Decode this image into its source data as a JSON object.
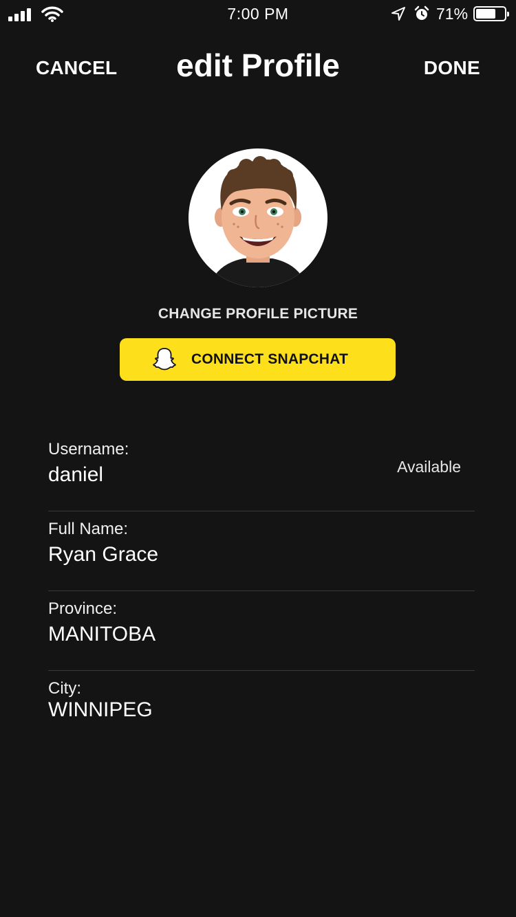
{
  "status_bar": {
    "time": "7:00 PM",
    "battery_percent": "71%",
    "battery_level": 0.71,
    "icons": [
      "signal-icon",
      "wifi-icon",
      "location-icon",
      "alarm-icon",
      "battery-icon"
    ]
  },
  "nav": {
    "cancel_label": "CANCEL",
    "title": "edit Profile",
    "done_label": "DONE"
  },
  "profile": {
    "avatar_icon": "bitmoji-avatar",
    "change_picture_label": "CHANGE PROFILE PICTURE",
    "snapchat_button_label": "CONNECT SNAPCHAT",
    "snapchat_icon": "snapchat-ghost-icon"
  },
  "colors": {
    "background": "#141414",
    "snapchat_yellow": "#fde01b",
    "divider": "#3a3a3a"
  },
  "fields": [
    {
      "label": "Username:",
      "value": "daniel",
      "status": "Available"
    },
    {
      "label": "Full Name:",
      "value": "Ryan Grace"
    },
    {
      "label": "Province:",
      "value": "MANITOBA"
    },
    {
      "label": "City:",
      "value": "WINNIPEG"
    }
  ]
}
